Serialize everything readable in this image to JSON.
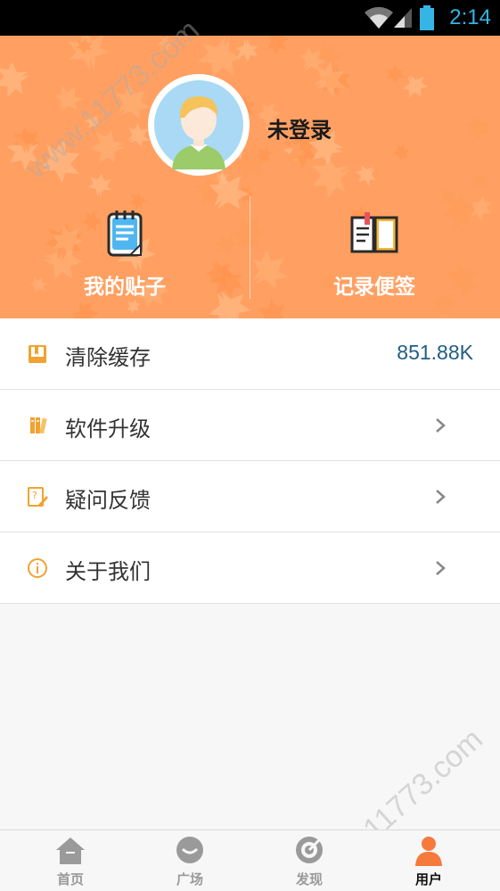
{
  "status_bar": {
    "time": "2:14"
  },
  "profile": {
    "login_status": "未登录"
  },
  "quick_actions": [
    {
      "label": "我的贴子",
      "icon": "notepad-icon"
    },
    {
      "label": "记录便签",
      "icon": "open-book-icon"
    }
  ],
  "menu": [
    {
      "label": "清除缓存",
      "icon": "cache-book-icon",
      "value": "851.88K"
    },
    {
      "label": "软件升级",
      "icon": "books-icon"
    },
    {
      "label": "疑问反馈",
      "icon": "question-note-icon"
    },
    {
      "label": "关于我们",
      "icon": "info-circle-icon"
    }
  ],
  "watermark": "www.11773.com",
  "tabbar": [
    {
      "label": "首页",
      "icon": "home-icon",
      "active": false
    },
    {
      "label": "广场",
      "icon": "chat-bubble-icon",
      "active": false
    },
    {
      "label": "发现",
      "icon": "discover-target-icon",
      "active": false
    },
    {
      "label": "用户",
      "icon": "user-icon",
      "active": true
    }
  ],
  "colors": {
    "header_bg": "#ffa062",
    "value_text": "#215e82",
    "active_tab_icon": "#f57a3c",
    "status_time": "#34b5e5"
  }
}
